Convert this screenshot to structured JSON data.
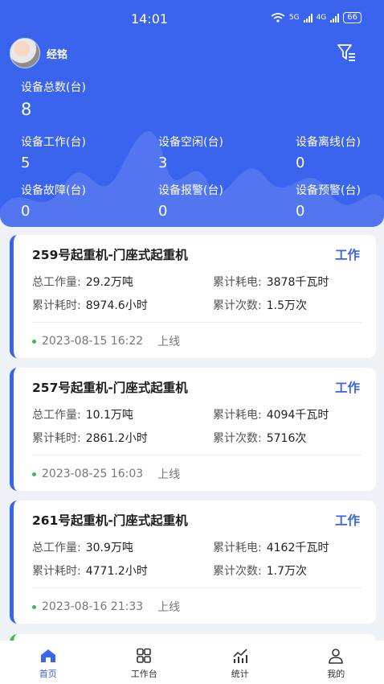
{
  "status_bar": {
    "time": "14:01",
    "network": "5G",
    "network2": "4G",
    "battery": "66"
  },
  "user": {
    "name": "经铭"
  },
  "summary": {
    "total_label": "设备总数(台)",
    "total_value": "8",
    "stats": [
      {
        "label": "设备工作(台)",
        "value": "5"
      },
      {
        "label": "设备空闲(台)",
        "value": "3"
      },
      {
        "label": "设备离线(台)",
        "value": "0"
      },
      {
        "label": "设备故障(台)",
        "value": "0"
      },
      {
        "label": "设备报警(台)",
        "value": "0"
      },
      {
        "label": "设备预警(台)",
        "value": "0"
      }
    ]
  },
  "labels": {
    "total_work": "总工作量:",
    "total_power": "累计耗电:",
    "total_hours": "累计耗时:",
    "total_count": "累计次数:"
  },
  "devices": [
    {
      "name": "259号起重机-门座式起重机",
      "status": "工作",
      "work": "29.2万吨",
      "power": "3878千瓦时",
      "hours": "8974.6小时",
      "count": "1.5万次",
      "time": "2023-08-15 16:22",
      "online": "上线"
    },
    {
      "name": "257号起重机-门座式起重机",
      "status": "工作",
      "work": "10.1万吨",
      "power": "4094千瓦时",
      "hours": "2861.2小时",
      "count": "5716次",
      "time": "2023-08-25 16:03",
      "online": "上线"
    },
    {
      "name": "261号起重机-门座式起重机",
      "status": "工作",
      "work": "30.9万吨",
      "power": "4162千瓦时",
      "hours": "4771.2小时",
      "count": "1.7万次",
      "time": "2023-08-16 21:33",
      "online": "上线"
    }
  ],
  "tabs": [
    {
      "label": "首页",
      "icon": "home-icon"
    },
    {
      "label": "工作台",
      "icon": "grid-icon"
    },
    {
      "label": "统计",
      "icon": "chart-icon"
    },
    {
      "label": "我的",
      "icon": "person-icon"
    }
  ],
  "colors": {
    "primary": "#3a63ee",
    "online": "#3fb950"
  }
}
